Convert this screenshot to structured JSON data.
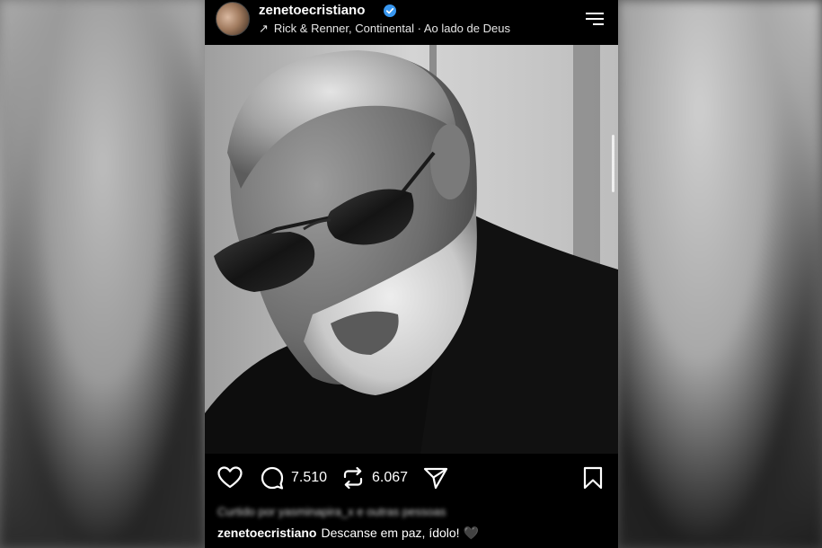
{
  "post": {
    "username": "zenetoecristiano",
    "audio": {
      "arrow": "↗",
      "track": "Rick & Renner, Continental · Ao lado de Deus"
    },
    "icons": {
      "verified": "verified-badge-icon",
      "menu": "menu-icon",
      "sound": "speaker-icon"
    },
    "accent": "#3897f0"
  },
  "actions": {
    "like_icon": "heart-icon",
    "comment_icon": "comment-icon",
    "comment_count": "7.510",
    "repost_icon": "repost-icon",
    "repost_count": "6.067",
    "share_icon": "send-icon",
    "save_icon": "bookmark-icon"
  },
  "likes_text": "Curtido por yasminapira_x e outras pessoas",
  "caption": {
    "username": "zenetoecristiano",
    "text": "Descanse em paz, ídolo! 🖤"
  }
}
